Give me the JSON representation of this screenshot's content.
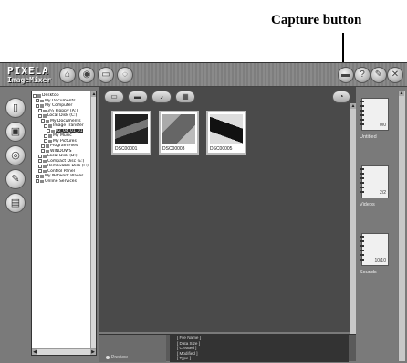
{
  "callout": {
    "label": "Capture button"
  },
  "app": {
    "logo_line1": "PIXELA",
    "logo_line2": "ImageMixer"
  },
  "tree": {
    "items": [
      {
        "label": "Desktop"
      },
      {
        "label": "My Documents"
      },
      {
        "label": "My Computer"
      },
      {
        "label": "3½ Floppy (A:)"
      },
      {
        "label": "Local Disk (C:)"
      },
      {
        "label": "My Documents"
      },
      {
        "label": "Image Transfer"
      },
      {
        "label": "02_04_01_01",
        "selected": true
      },
      {
        "label": "My Music"
      },
      {
        "label": "My Pictures"
      },
      {
        "label": "Program Files"
      },
      {
        "label": "WINDOWS"
      },
      {
        "label": "Local Disk (D:)"
      },
      {
        "label": "Compact Disc (E:)"
      },
      {
        "label": "Removable Disk (F:)"
      },
      {
        "label": "Control Panel"
      },
      {
        "label": "My Network Places"
      },
      {
        "label": "Online Services"
      }
    ]
  },
  "thumbnails": [
    {
      "name": "DSC00001"
    },
    {
      "name": "DSC00003"
    },
    {
      "name": "DSC00005"
    }
  ],
  "info": {
    "preview_label": "Preview",
    "fields": [
      "[ File Name ]",
      "[ Data Size ]",
      "[ Created ]",
      "[ Modified ]",
      "[ Type ]"
    ]
  },
  "albums": [
    {
      "label": "Untitled",
      "count": "0/0"
    },
    {
      "label": "Videos",
      "count": "2/2"
    },
    {
      "label": "Sounds",
      "count": "10/10"
    }
  ]
}
